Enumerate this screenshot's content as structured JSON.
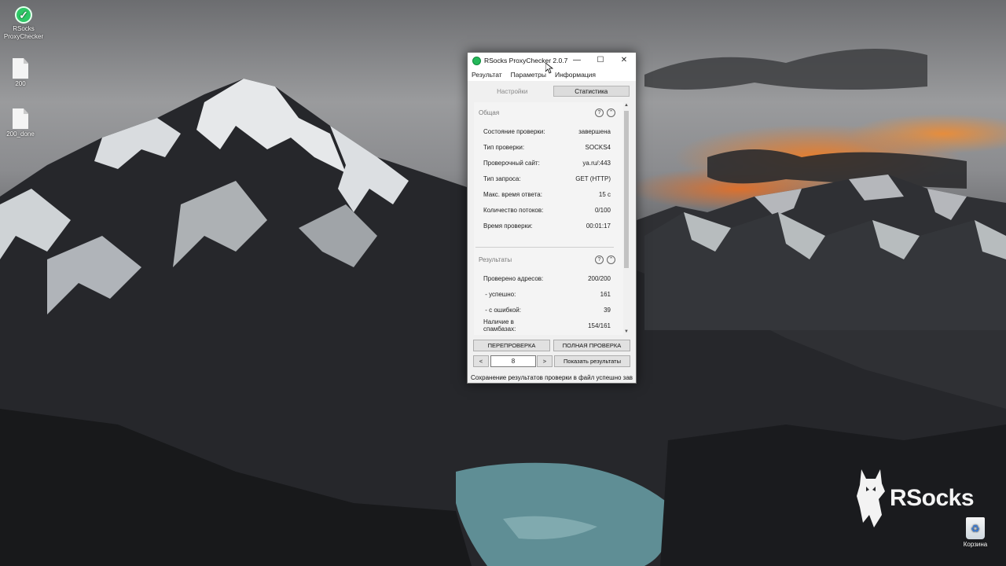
{
  "desktop": {
    "icons": [
      {
        "name": "rsocks-proxychecker",
        "label_line1": "RSocks",
        "label_line2": "ProxyChecker"
      },
      {
        "name": "file-200",
        "label": "200"
      },
      {
        "name": "file-200-done",
        "label": "200_done"
      }
    ],
    "recycle_bin": {
      "label": "Корзина"
    },
    "watermark": {
      "text": "RSocks"
    }
  },
  "window": {
    "title": "RSocks ProxyChecker 2.0.7",
    "controls": {
      "minimize": "—",
      "maximize": "☐",
      "close": "✕"
    },
    "menu": [
      "Результат",
      "Параметры",
      "Информация"
    ],
    "tabs": [
      {
        "label": "Настройки",
        "active": false
      },
      {
        "label": "Статистика",
        "active": true
      }
    ],
    "general": {
      "title": "Общая",
      "rows": [
        {
          "label": "Состояние проверки:",
          "value": "завершена"
        },
        {
          "label": "Тип проверки:",
          "value": "SOCKS4"
        },
        {
          "label": "Проверочный сайт:",
          "value": "ya.ru/:443"
        },
        {
          "label": "Тип запроса:",
          "value": "GET (HTTP)"
        },
        {
          "label": "Макс. время ответа:",
          "value": "15 с"
        },
        {
          "label": "Количество потоков:",
          "value": "0/100"
        },
        {
          "label": "Время проверки:",
          "value": "00:01:17"
        }
      ]
    },
    "results": {
      "title": "Результаты",
      "rows": [
        {
          "label": "Проверено адресов:",
          "value": "200/200"
        },
        {
          "label": " - успешно:",
          "value": "161"
        },
        {
          "label": " - с ошибкой:",
          "value": "39"
        },
        {
          "label": "Наличие в спамбазах:",
          "value": "154/161"
        }
      ]
    },
    "buttons": {
      "recheck": "ПЕРЕПРОВЕРКА",
      "full_check": "ПОЛНАЯ ПРОВЕРКА",
      "prev": "<",
      "next": ">",
      "show_results": "Показать результаты"
    },
    "page_value": "8",
    "status": "Сохранение результатов проверки в файл успешно зав"
  },
  "colors": {
    "accent_green": "#25b85a",
    "sunset_orange": "#eb7d28"
  }
}
